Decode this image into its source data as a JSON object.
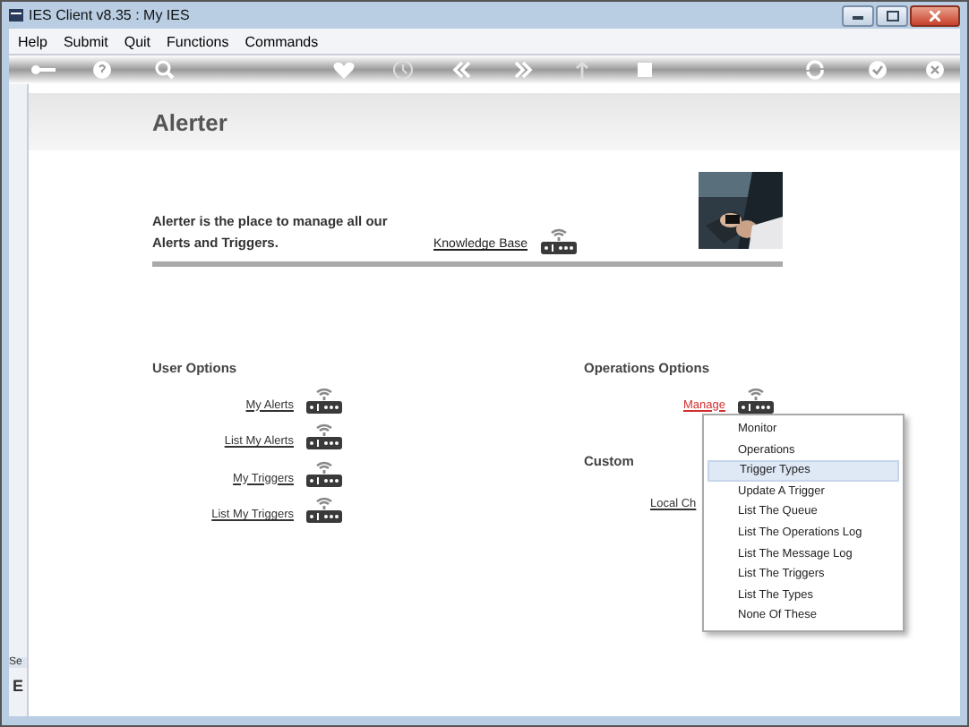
{
  "window": {
    "title": "IES Client v8.35 : My IES"
  },
  "menu": [
    "Help",
    "Submit",
    "Quit",
    "Functions",
    "Commands"
  ],
  "page": {
    "title": "Alerter",
    "intro": "Alerter is the place to manage all our Alerts and Triggers.",
    "knowledge_link": "Knowledge Base"
  },
  "user_options": {
    "title": "User Options",
    "links": [
      "My Alerts",
      "List My Alerts",
      "My Triggers",
      "List My Triggers"
    ]
  },
  "operations_options": {
    "title": "Operations Options",
    "links": [
      {
        "label": "Manage",
        "active": true
      }
    ]
  },
  "custom": {
    "title": "Custom",
    "links": [
      "Local Ch"
    ]
  },
  "dropdown": [
    {
      "label": "Monitor",
      "selected": false
    },
    {
      "label": "Operations",
      "selected": false
    },
    {
      "label": "Trigger Types",
      "selected": true
    },
    {
      "label": "Update A Trigger",
      "selected": false
    },
    {
      "label": "List The Queue",
      "selected": false
    },
    {
      "label": "List The Operations Log",
      "selected": false
    },
    {
      "label": "List The Message Log",
      "selected": false
    },
    {
      "label": "List The Triggers",
      "selected": false
    },
    {
      "label": "List The Types",
      "selected": false
    },
    {
      "label": "None Of These",
      "selected": false
    }
  ],
  "side_strip": [
    "Se",
    "E"
  ]
}
